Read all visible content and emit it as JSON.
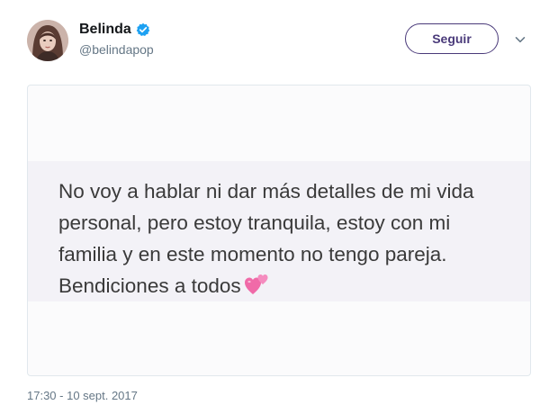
{
  "author": {
    "name": "Belinda",
    "handle": "@belindapop",
    "verified": true,
    "avatar_icon": "profile-photo"
  },
  "actions": {
    "follow_label": "Seguir",
    "more_icon": "chevron-down-icon"
  },
  "media": {
    "lines": [
      "No voy a hablar ni dar más detalles de mi vida",
      "personal, pero estoy tranquila, estoy con mi",
      "familia  y en este momento no tengo pareja.",
      "Bendiciones a todos"
    ],
    "emoji": "two-hearts-icon"
  },
  "timestamp": "17:30 - 10 sept. 2017",
  "colors": {
    "verified_badge": "#1da1f2",
    "follow_button": "#4a3a7a",
    "heart": "#f06aa8"
  }
}
